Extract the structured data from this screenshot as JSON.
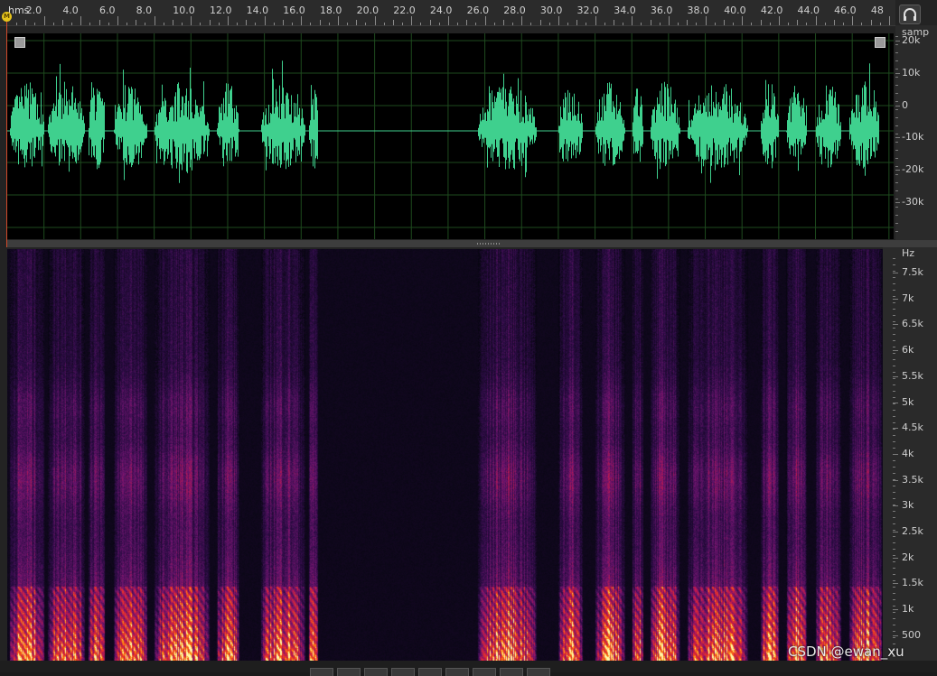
{
  "ruler": {
    "units_label": "hms",
    "labels": [
      "2.0",
      "4.0",
      "6.0",
      "8.0",
      "10.0",
      "12.0",
      "14.0",
      "16.0",
      "18.0",
      "20.0",
      "22.0",
      "24.0",
      "26.0",
      "28.0",
      "30.0",
      "32.0",
      "34.0",
      "36.0",
      "38.0",
      "40.0",
      "42.0",
      "44.0",
      "46.0",
      "48"
    ],
    "playhead_glyph": "M"
  },
  "amplitude_scale": {
    "unit": "samp",
    "labels": [
      "20k",
      "10k",
      "0",
      "-10k",
      "-20k",
      "-30k"
    ]
  },
  "frequency_scale": {
    "unit": "Hz",
    "labels": [
      "7.5k",
      "7k",
      "6.5k",
      "6k",
      "5.5k",
      "5k",
      "4.5k",
      "4k",
      "3.5k",
      "3k",
      "2.5k",
      "2k",
      "1.5k",
      "1k",
      "500"
    ]
  },
  "watermark": "CSDN @ewan_xu",
  "colors": {
    "waveform": "#3fd08e",
    "waveform_bg": "#000000",
    "grid": "#1e4a1e",
    "playhead": "#e7c51b"
  },
  "speech_segments_seconds": [
    [
      0.1,
      2.0
    ],
    [
      2.2,
      4.2
    ],
    [
      4.4,
      5.3
    ],
    [
      5.8,
      7.6
    ],
    [
      8.0,
      11.0
    ],
    [
      11.4,
      12.6
    ],
    [
      13.8,
      16.2
    ],
    [
      16.4,
      16.9
    ],
    [
      25.6,
      28.8
    ],
    [
      30.0,
      31.3
    ],
    [
      32.0,
      33.6
    ],
    [
      34.0,
      34.6
    ],
    [
      35.0,
      36.6
    ],
    [
      37.0,
      40.3
    ],
    [
      41.0,
      42.0
    ],
    [
      42.4,
      43.5
    ],
    [
      44.0,
      45.4
    ],
    [
      45.8,
      47.6
    ]
  ]
}
